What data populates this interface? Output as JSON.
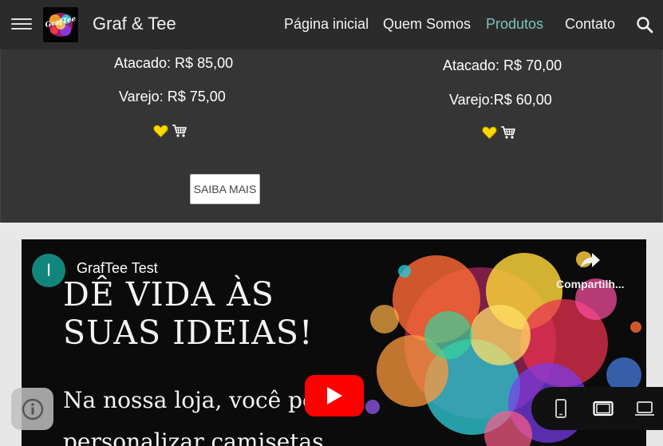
{
  "header": {
    "site_title": "Graf & Tee",
    "logo_text": "GrafTee",
    "nav": [
      {
        "label": "Página inicial",
        "active": false
      },
      {
        "label": "Quem Somos",
        "active": false
      },
      {
        "label": "Produtos",
        "active": true
      },
      {
        "label": "Contato",
        "active": false
      }
    ],
    "menu_icon": "hamburger-menu-icon",
    "search_icon": "search-icon"
  },
  "products": [
    {
      "wholesale": "Atacado: R$ 85,00",
      "retail": "Varejo: R$ 75,00"
    },
    {
      "wholesale": "Atacado: R$ 70,00",
      "retail": "Varejo:R$ 60,00"
    }
  ],
  "saiba_mais_label": "SAIBA MAIS",
  "video": {
    "channel_initial": "I",
    "channel_name": "GrafTee Test",
    "share_label": "Compartilh...",
    "headline_line1": "DÊ VIDA ÀS",
    "headline_line2": "SUAS IDEIAS!",
    "tagline_line1": "Na nossa loja, você po",
    "tagline_line2": "personalizar camisetas"
  },
  "colors": {
    "header_bg": "#2b2b2b",
    "products_bg": "#353535",
    "active_nav": "#7ec4c0",
    "heart": "#ffd800",
    "play_red": "#ff0000",
    "channel_avatar": "#12867c"
  }
}
